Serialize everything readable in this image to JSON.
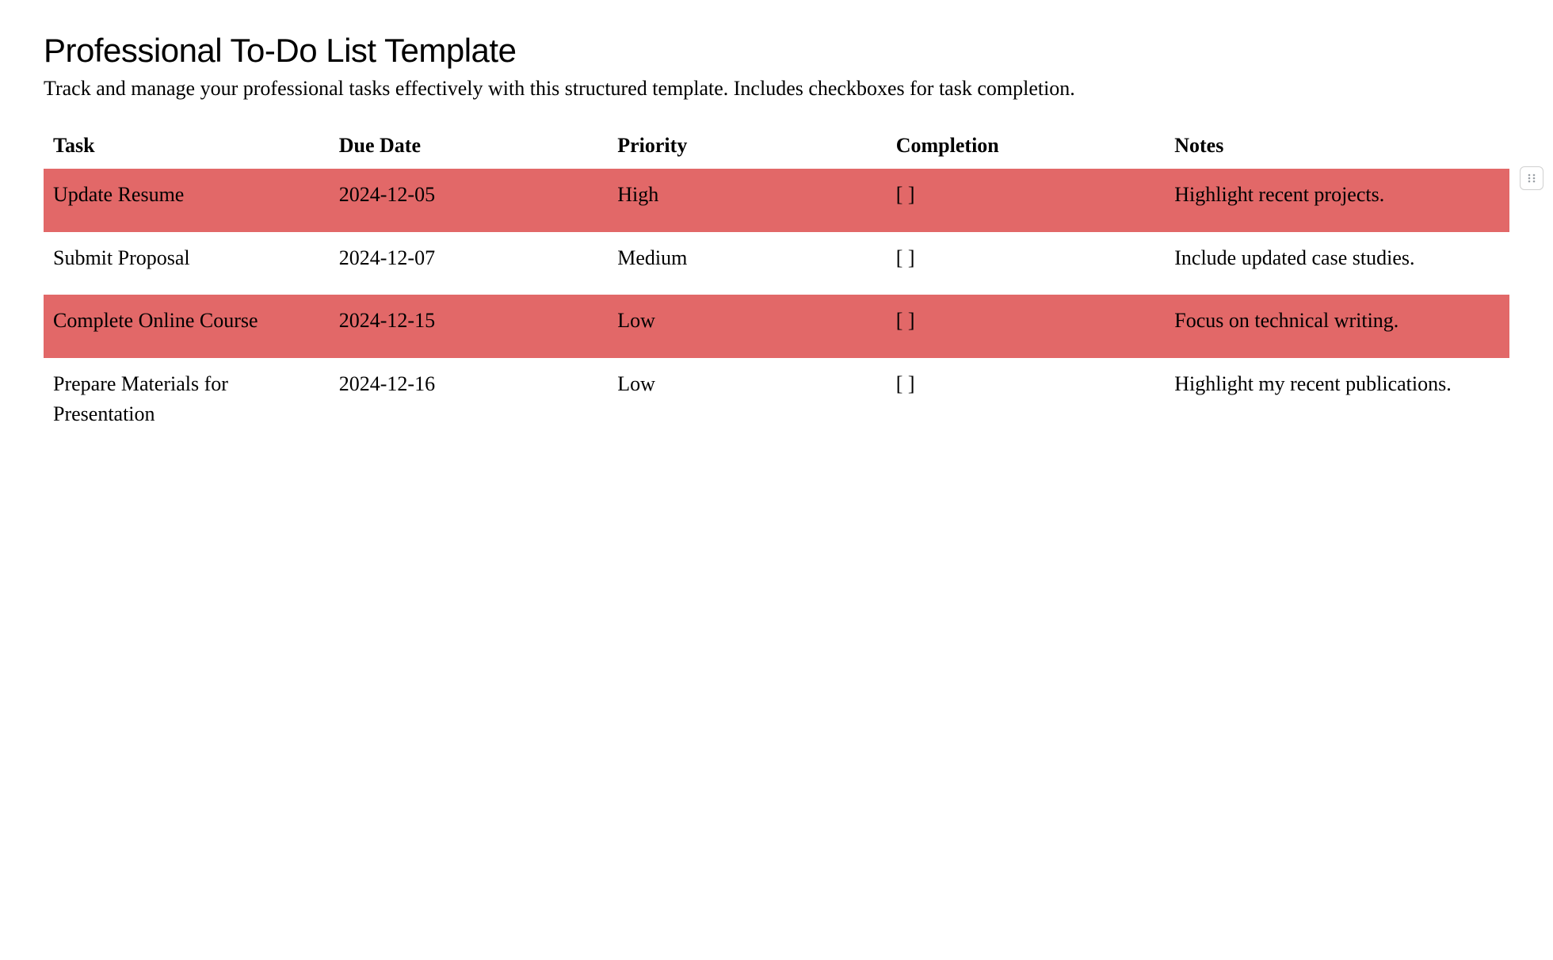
{
  "header": {
    "title": "Professional To-Do List Template",
    "subtitle": "Track and manage your professional tasks effectively with this structured template. Includes checkboxes for task completion."
  },
  "table": {
    "columns": {
      "task": "Task",
      "due": "Due Date",
      "priority": "Priority",
      "completion": "Completion",
      "notes": "Notes"
    },
    "rows": [
      {
        "task": "Update Resume",
        "due": "2024-12-05",
        "priority": "High",
        "completion": "[ ]",
        "notes": "Highlight recent projects.",
        "highlight": true
      },
      {
        "task": "Submit Proposal",
        "due": "2024-12-07",
        "priority": "Medium",
        "completion": "[ ]",
        "notes": "Include updated case studies.",
        "highlight": false
      },
      {
        "task": "Complete Online Course",
        "due": "2024-12-15",
        "priority": "Low",
        "completion": "[ ]",
        "notes": "Focus on technical writing.",
        "highlight": true
      },
      {
        "task": "Prepare Materials for Presentation",
        "due": "2024-12-16",
        "priority": "Low",
        "completion": "[ ]",
        "notes": "Highlight my recent publications.",
        "highlight": false
      }
    ]
  }
}
